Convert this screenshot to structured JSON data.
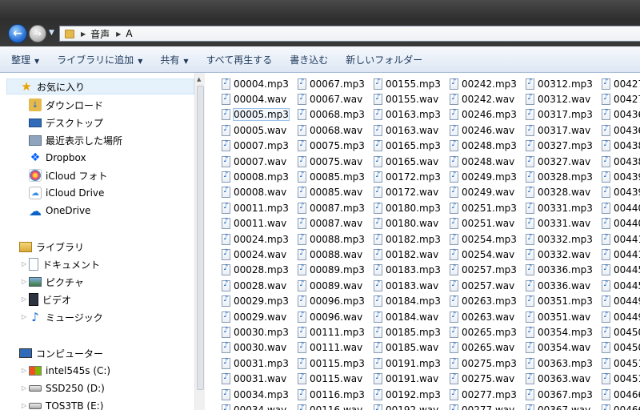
{
  "address": {
    "crumbs": [
      "音声",
      "A"
    ]
  },
  "toolbar": {
    "organize": "整理",
    "include_library": "ライブラリに追加",
    "share": "共有",
    "play_all": "すべて再生する",
    "burn": "書き込む",
    "new_folder": "新しいフォルダー"
  },
  "nav": {
    "favorites": {
      "label": "お気に入り",
      "items": [
        "ダウンロード",
        "デスクトップ",
        "最近表示した場所",
        "Dropbox",
        "iCloud フォト",
        "iCloud Drive",
        "OneDrive"
      ]
    },
    "libraries": {
      "label": "ライブラリ",
      "items": [
        "ドキュメント",
        "ピクチャ",
        "ビデオ",
        "ミュージック"
      ]
    },
    "computer": {
      "label": "コンピューター",
      "items": [
        "intel545s (C:)",
        "SSD250 (D:)",
        "TOS3TB (E:)"
      ]
    }
  },
  "files": {
    "selected": "00005.mp3",
    "col0": [
      "00004.mp3",
      "00004.wav",
      "00005.mp3",
      "00005.wav",
      "00007.mp3",
      "00007.wav",
      "00008.mp3",
      "00008.wav",
      "00011.mp3",
      "00011.wav",
      "00024.mp3",
      "00024.wav",
      "00028.mp3",
      "00028.wav",
      "00029.mp3",
      "00029.wav",
      "00030.mp3",
      "00030.wav",
      "00031.mp3",
      "00031.wav",
      "00034.mp3",
      "00034.wav"
    ],
    "col1": [
      "00067.mp3",
      "00067.wav",
      "00068.mp3",
      "00068.wav",
      "00075.mp3",
      "00075.wav",
      "00085.mp3",
      "00085.wav",
      "00087.mp3",
      "00087.wav",
      "00088.mp3",
      "00088.wav",
      "00089.mp3",
      "00089.wav",
      "00096.mp3",
      "00096.wav",
      "00111.mp3",
      "00111.wav",
      "00115.mp3",
      "00115.wav",
      "00116.mp3",
      "00116.wav"
    ],
    "col2": [
      "00155.mp3",
      "00155.wav",
      "00163.mp3",
      "00163.wav",
      "00165.mp3",
      "00165.wav",
      "00172.mp3",
      "00172.wav",
      "00180.mp3",
      "00180.wav",
      "00182.mp3",
      "00182.wav",
      "00183.mp3",
      "00183.wav",
      "00184.mp3",
      "00184.wav",
      "00185.mp3",
      "00185.wav",
      "00191.mp3",
      "00191.wav",
      "00192.mp3",
      "00192.wav"
    ],
    "col3": [
      "00242.mp3",
      "00242.wav",
      "00246.mp3",
      "00246.wav",
      "00248.mp3",
      "00248.wav",
      "00249.mp3",
      "00249.wav",
      "00251.mp3",
      "00251.wav",
      "00254.mp3",
      "00254.wav",
      "00257.mp3",
      "00257.wav",
      "00263.mp3",
      "00263.wav",
      "00265.mp3",
      "00265.wav",
      "00275.mp3",
      "00275.wav",
      "00277.mp3",
      "00277.wav"
    ],
    "col4": [
      "00312.mp3",
      "00312.wav",
      "00317.mp3",
      "00317.wav",
      "00327.mp3",
      "00327.wav",
      "00328.mp3",
      "00328.wav",
      "00331.mp3",
      "00331.wav",
      "00332.mp3",
      "00332.wav",
      "00336.mp3",
      "00336.wav",
      "00351.mp3",
      "00351.wav",
      "00354.mp3",
      "00354.wav",
      "00363.mp3",
      "00363.wav",
      "00367.mp3",
      "00367.wav"
    ],
    "col5": [
      "00427",
      "00427",
      "00436",
      "00436",
      "00438",
      "00438",
      "00439",
      "00439",
      "00440",
      "00440",
      "00441",
      "00441",
      "00445",
      "00445",
      "00449",
      "00449",
      "00450",
      "00450",
      "00451",
      "00451",
      "00466",
      "00466"
    ]
  },
  "colors": {
    "accent": "#1e395b",
    "selection": "#9ec3e6",
    "hover": "#e5f1fb"
  }
}
